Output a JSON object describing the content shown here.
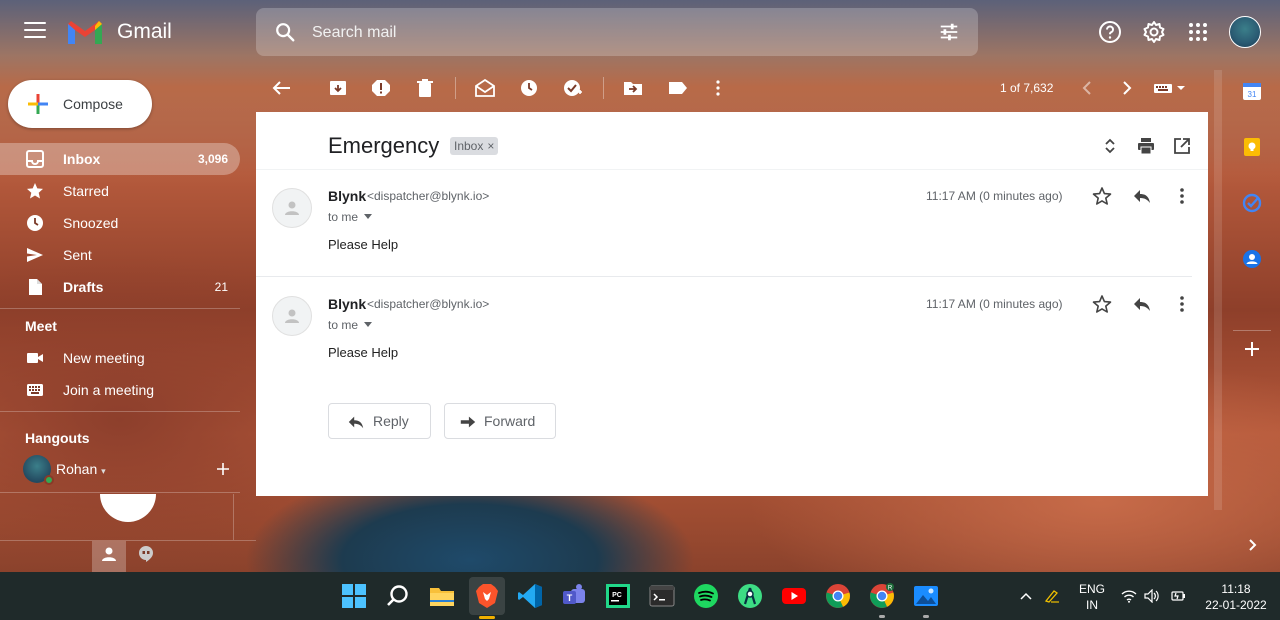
{
  "app": {
    "name": "Gmail"
  },
  "search": {
    "placeholder": "Search mail"
  },
  "compose": {
    "label": "Compose"
  },
  "nav": {
    "items": [
      {
        "label": "Inbox",
        "count": "3,096"
      },
      {
        "label": "Starred",
        "count": ""
      },
      {
        "label": "Snoozed",
        "count": ""
      },
      {
        "label": "Sent",
        "count": ""
      },
      {
        "label": "Drafts",
        "count": "21"
      }
    ]
  },
  "meet": {
    "title": "Meet",
    "new_meeting": "New meeting",
    "join_meeting": "Join a meeting"
  },
  "hangouts": {
    "title": "Hangouts",
    "user": "Rohan"
  },
  "pager": {
    "text": "1 of 7,632"
  },
  "thread": {
    "subject": "Emergency",
    "label": "Inbox",
    "label_close": "×",
    "messages": [
      {
        "sender": "Blynk",
        "email": "<dispatcher@blynk.io>",
        "to": "to me",
        "time": "11:17 AM (0 minutes ago)",
        "body": "Please Help"
      },
      {
        "sender": "Blynk",
        "email": "<dispatcher@blynk.io>",
        "to": "to me",
        "time": "11:17 AM (0 minutes ago)",
        "body": "Please Help"
      }
    ],
    "reply_label": "Reply",
    "forward_label": "Forward"
  },
  "taskbar": {
    "lang_top": "ENG",
    "lang_bottom": "IN",
    "time": "11:18",
    "date": "22-01-2022"
  },
  "colors": {
    "gmail_red": "#ea4335",
    "gmail_blue": "#4285f4",
    "gmail_green": "#34a853",
    "gmail_yellow": "#fbbc04",
    "panel_bg": "#ffffff",
    "taskbar_bg": "#1f2a2a"
  }
}
